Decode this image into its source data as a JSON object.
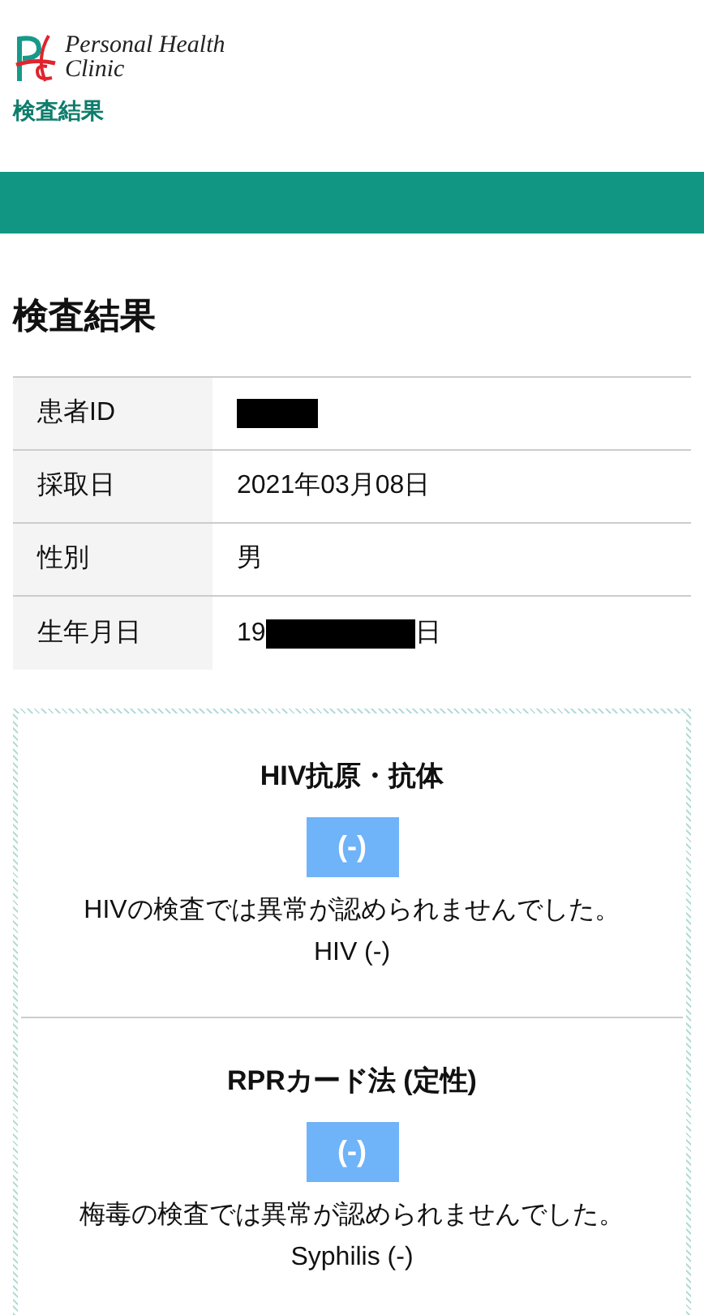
{
  "header": {
    "logo_line_1": "Personal Health",
    "logo_line_2": "Clinic",
    "subtitle": "検査結果"
  },
  "page_title": "検査結果",
  "info_rows": [
    {
      "label": "患者ID",
      "value_before": "",
      "redacted": true,
      "value_after": ""
    },
    {
      "label": "採取日",
      "value_before": "2021年03月08日",
      "redacted": false,
      "value_after": ""
    },
    {
      "label": "性別",
      "value_before": "男",
      "redacted": false,
      "value_after": ""
    },
    {
      "label": "生年月日",
      "value_before": "19",
      "redacted": true,
      "value_after": "日"
    }
  ],
  "results": [
    {
      "title": "HIV抗原・抗体",
      "result": "(-)",
      "description": "HIVの検査では異常が認められませんでした。HIV (-)"
    },
    {
      "title": "RPRカード法 (定性)",
      "result": "(-)",
      "description": "梅毒の検査では異常が認められませんでした。Syphilis (-)"
    }
  ]
}
